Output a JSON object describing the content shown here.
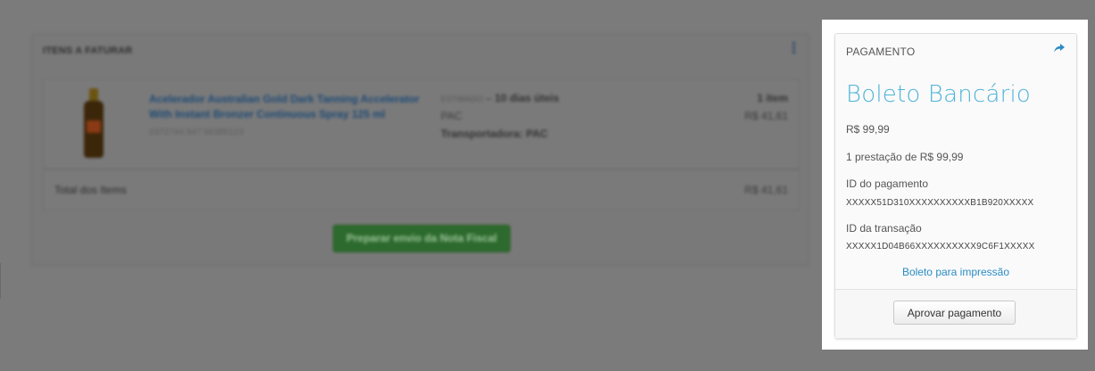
{
  "items_panel": {
    "title": "ITENS A FATURAR",
    "menu_icon": "vertical-dots-icon",
    "item": {
      "name": "Acelerador Australian Gold Dark Tanning Accelerator With Instant Bronzer Continuous Spray 125 ml",
      "sku": "2372744 547 56385123",
      "estimate_key": "ESTIMADO",
      "estimate_value": "10 dias úteis",
      "shipping_method": "PAC",
      "carrier_label": "Transportadora: PAC",
      "quantity": "1 item",
      "price": "R$ 41,61"
    },
    "total_label": "Total dos Items",
    "total_value": "R$ 41,61",
    "prepare_button": "Preparar envio da Nota Fiscal"
  },
  "payment": {
    "title": "PAGAMENTO",
    "share_icon": "share-arrow-icon",
    "method": "Boleto Bancário",
    "amount": "R$ 99,99",
    "installments": "1 prestação de R$ 99,99",
    "payment_id_label": "ID do pagamento",
    "payment_id": "XXXXX51D310XXXXXXXXXXB1B920XXXXX",
    "transaction_id_label": "ID da transação",
    "transaction_id": "XXXXX1D04B66XXXXXXXXXX9C6F1XXXXX",
    "print_link": "Boleto para impressão",
    "approve_button": "Aprovar pagamento",
    "accent_color": "#4fb4d8",
    "link_color": "#2b8cc4"
  }
}
